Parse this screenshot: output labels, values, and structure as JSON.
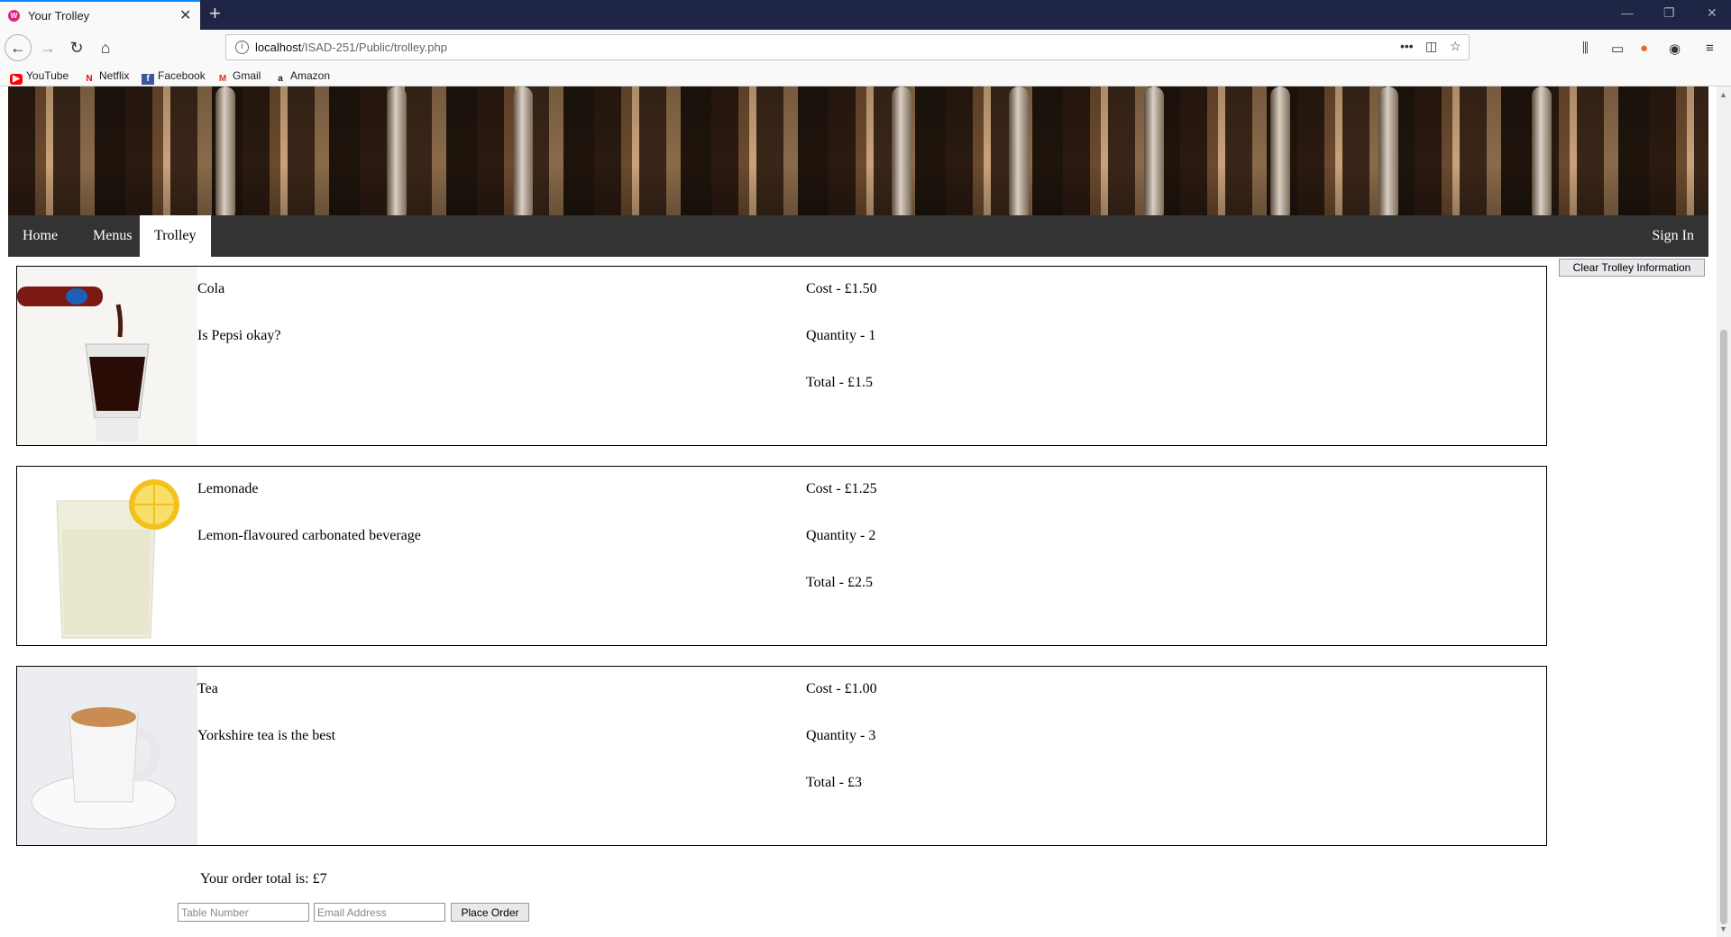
{
  "browser": {
    "tab_title": "Your Trolley",
    "url_host": "localhost",
    "url_path": "/ISAD-251/Public/trolley.php",
    "bookmarks": [
      "YouTube",
      "Netflix",
      "Facebook",
      "Gmail",
      "Amazon"
    ]
  },
  "nav": {
    "home": "Home",
    "menus": "Menus",
    "trolley": "Trolley",
    "sign_in": "Sign In"
  },
  "clear_button": "Clear Trolley Information",
  "items": [
    {
      "name": "Cola",
      "description": "Is Pepsi okay?",
      "cost": "Cost - £1.50",
      "quantity": "Quantity - 1",
      "total": "Total - £1.5"
    },
    {
      "name": "Lemonade",
      "description": "Lemon-flavoured carbonated beverage",
      "cost": "Cost - £1.25",
      "quantity": "Quantity - 2",
      "total": "Total - £2.5"
    },
    {
      "name": "Tea",
      "description": "Yorkshire tea is the best",
      "cost": "Cost - £1.00",
      "quantity": "Quantity - 3",
      "total": "Total - £3"
    }
  ],
  "order": {
    "total_text": "Your order total is: £7",
    "table_placeholder": "Table Number",
    "email_placeholder": "Email Address",
    "place_button": "Place Order"
  }
}
